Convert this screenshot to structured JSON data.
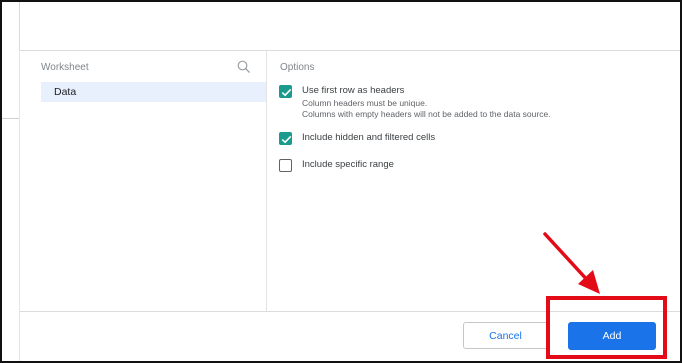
{
  "worksheet": {
    "title": "Worksheet",
    "items": [
      {
        "label": "Data"
      }
    ]
  },
  "options": {
    "title": "Options",
    "items": [
      {
        "label": "Use first row as headers",
        "checked": true,
        "help": [
          "Column headers must be unique.",
          "Columns with empty headers will not be added to the data source."
        ]
      },
      {
        "label": "Include hidden and filtered cells",
        "checked": true
      },
      {
        "label": "Include specific range",
        "checked": false
      }
    ]
  },
  "footer": {
    "cancel_label": "Cancel",
    "add_label": "Add"
  },
  "annotation": {
    "color": "#e30b17"
  },
  "colors": {
    "accent": "#1a73e8",
    "checkbox": "#1a9b8e",
    "selected_row": "#e8f0fe"
  },
  "icons": {
    "search": "search-icon",
    "check": "check-icon",
    "arrow": "arrow-annotation"
  }
}
